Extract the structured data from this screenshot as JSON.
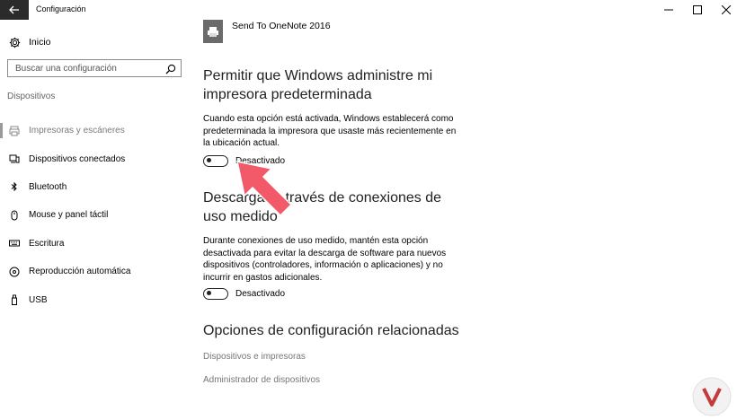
{
  "window": {
    "title": "Configuración",
    "controls": [
      "minimize-icon",
      "maximize-icon",
      "close-icon"
    ]
  },
  "sidebar": {
    "home_label": "Inicio",
    "search": {
      "placeholder": "Buscar una configuración",
      "value": ""
    },
    "section_label": "Dispositivos",
    "items": [
      {
        "label": "Impresoras y escáneres",
        "icon": "printer-icon",
        "active": true
      },
      {
        "label": "Dispositivos conectados",
        "icon": "devices-icon",
        "active": false
      },
      {
        "label": "Bluetooth",
        "icon": "bluetooth-icon",
        "active": false
      },
      {
        "label": "Mouse y panel táctil",
        "icon": "mouse-icon",
        "active": false
      },
      {
        "label": "Escritura",
        "icon": "keyboard-icon",
        "active": false
      },
      {
        "label": "Reproducción automática",
        "icon": "autoplay-icon",
        "active": false
      },
      {
        "label": "USB",
        "icon": "usb-icon",
        "active": false
      }
    ]
  },
  "main": {
    "printer_name": "Send To OneNote 2016",
    "default_printer": {
      "heading": "Permitir que Windows administre mi impresora predeterminada",
      "description": "Cuando esta opción está activada, Windows establecerá como predeterminada la impresora que usaste más recientemente en la ubicación actual.",
      "toggle_label": "Desactivado",
      "toggle_on": false
    },
    "metered": {
      "heading": "Descargar a través de conexiones de uso medido",
      "description": "Durante conexiones de uso medido, mantén esta opción desactivada para evitar la descarga de software para nuevos dispositivos (controladores, información o aplicaciones) y no incurrir en gastos adicionales.",
      "toggle_label": "Desactivado",
      "toggle_on": false
    },
    "related": {
      "heading": "Opciones de configuración relacionadas",
      "links": [
        "Dispositivos e impresoras",
        "Administrador de dispositivos"
      ]
    }
  },
  "colors": {
    "accent": "#2b2b2b",
    "arrow": "#f25a6a",
    "muted_text": "#777777"
  }
}
